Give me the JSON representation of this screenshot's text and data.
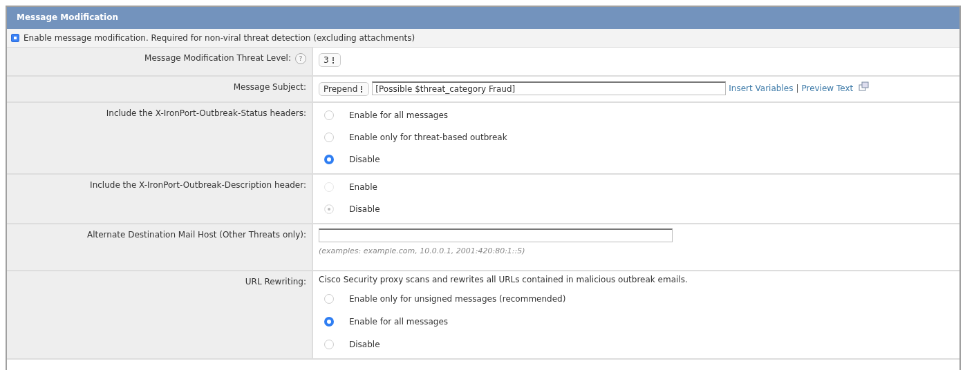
{
  "panel": {
    "title": "Message Modification"
  },
  "enable_row": {
    "checked": true,
    "label": "Enable message modification. Required for non-viral threat detection (excluding attachments)"
  },
  "rows": [
    {
      "kind": "select",
      "label": "Message Modification Threat Level:",
      "help": "?",
      "select": "3"
    },
    {
      "kind": "subject",
      "label": "Message Subject:",
      "select": "Prepend",
      "value": "[Possible $threat_category Fraud]",
      "links": [
        "Insert Variables",
        "Preview Text"
      ],
      "separator": "|"
    },
    {
      "kind": "radios",
      "label": "Include the X-IronPort-Outbreak-Status headers:",
      "options": [
        {
          "label": "Enable for all messages",
          "selected": false,
          "disabled": false
        },
        {
          "label": "Enable only for threat-based outbreak",
          "selected": false,
          "disabled": false
        },
        {
          "label": "Disable",
          "selected": true,
          "disabled": false
        }
      ]
    },
    {
      "kind": "radios",
      "label": "Include the X-IronPort-Outbreak-Description header:",
      "options": [
        {
          "label": "Enable",
          "selected": false,
          "disabled": true
        },
        {
          "label": "Disable",
          "selected": true,
          "disabled": true
        }
      ]
    },
    {
      "kind": "input",
      "label": "Alternate Destination Mail Host (Other Threats only):",
      "hint": "(examples: example.com, 10.0.0.1, 2001:420:80:1::5)"
    },
    {
      "kind": "radios",
      "label": "URL Rewriting:",
      "note": "Cisco Security proxy scans and rewrites all URLs contained in malicious outbreak emails.",
      "options": [
        {
          "label": "Enable only for unsigned messages (recommended)",
          "selected": false,
          "disabled": false
        },
        {
          "label": "Enable for all messages",
          "selected": true,
          "disabled": false
        },
        {
          "label": "Disable",
          "selected": false,
          "disabled": false
        }
      ]
    }
  ]
}
